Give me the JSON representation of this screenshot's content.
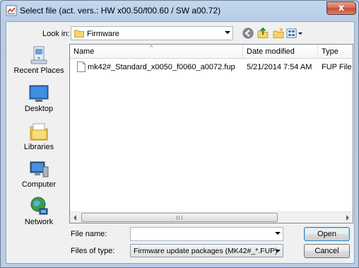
{
  "window": {
    "title": "Select file (act. vers.: HW x00.50/f00.60 / SW a00.72)",
    "close_glyph": "x"
  },
  "toolbar": {
    "look_in_label": "Look in:",
    "look_in_value": "Firmware",
    "buttons": [
      "back-icon",
      "up-folder-icon",
      "new-folder-icon",
      "view-menu-icon"
    ]
  },
  "places": [
    {
      "label": "Recent Places",
      "icon": "recent-places-icon"
    },
    {
      "label": "Desktop",
      "icon": "desktop-icon"
    },
    {
      "label": "Libraries",
      "icon": "libraries-icon"
    },
    {
      "label": "Computer",
      "icon": "computer-icon"
    },
    {
      "label": "Network",
      "icon": "network-icon"
    }
  ],
  "file_list": {
    "columns": [
      "Name",
      "Date modified",
      "Type"
    ],
    "rows": [
      {
        "name": "mk42#_Standard_x0050_f0060_a0072.fup",
        "date": "5/21/2014 7:54 AM",
        "type": "FUP File"
      }
    ]
  },
  "form": {
    "file_name_label": "File name:",
    "file_name_value": "",
    "file_type_label": "Files of type:",
    "file_type_value": "Firmware update packages (MK42#_*.FUP)",
    "open_label": "Open",
    "cancel_label": "Cancel"
  },
  "colors": {
    "title_bar": "#c3d7ee",
    "close_button": "#c44a30",
    "dialog_bg": "#f0f0f0"
  }
}
